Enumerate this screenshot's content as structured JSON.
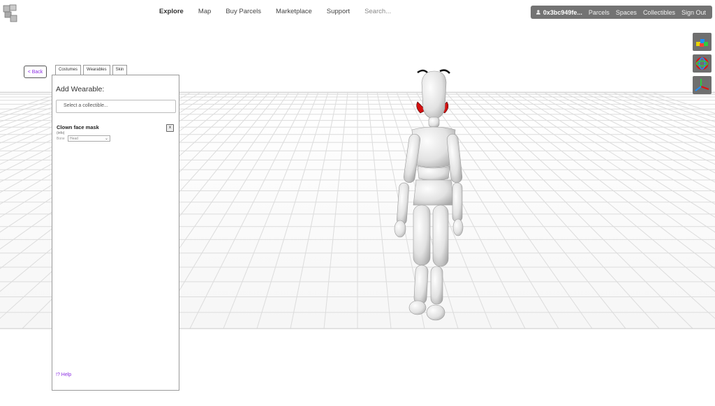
{
  "nav": {
    "links": [
      {
        "label": "Explore",
        "active": true
      },
      {
        "label": "Map"
      },
      {
        "label": "Buy Parcels"
      },
      {
        "label": "Marketplace"
      },
      {
        "label": "Support"
      }
    ],
    "search_label": "Search...",
    "logo_icon": "cube-stack-logo-icon"
  },
  "account": {
    "user_icon": "user-icon",
    "address": "0x3bc949fe...",
    "items": [
      "Parcels",
      "Spaces",
      "Collectibles",
      "Sign Out"
    ],
    "bar_color": "#737373"
  },
  "editor": {
    "back_label": "< Back",
    "tabs": [
      "Costumes",
      "Wearables",
      "Skin"
    ],
    "active_tab": "Wearables",
    "title": "Add Wearable:",
    "select_placeholder": "Select a collectible...",
    "wearable": {
      "name": "Clown face mask",
      "info": "(info)",
      "bone_label": "Bone",
      "bone_value": "Head",
      "remove_label": "x"
    },
    "help_label": "!? Help",
    "accent_color": "#8a2be2"
  },
  "tools": [
    {
      "icon": "move-blocks-icon"
    },
    {
      "icon": "rotate-gizmo-icon"
    },
    {
      "icon": "axis-gizmo-icon"
    }
  ]
}
